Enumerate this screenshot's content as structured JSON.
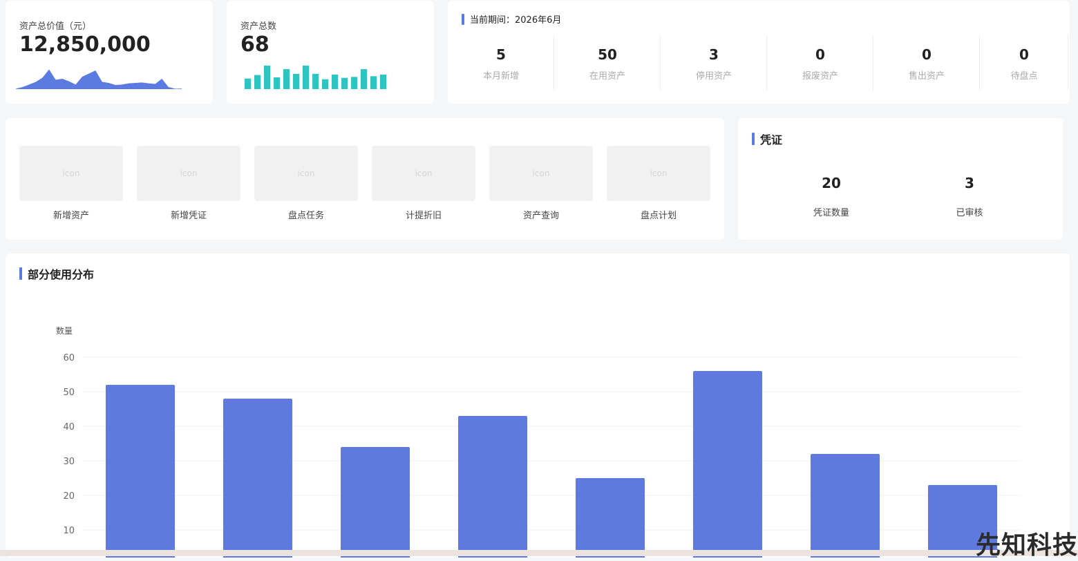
{
  "asset_value": {
    "label": "资产总价值（元）",
    "value": "12,850,000"
  },
  "asset_count": {
    "label": "资产总数",
    "value": "68",
    "bars": [
      0.45,
      0.6,
      1.0,
      0.5,
      0.85,
      0.65,
      1.0,
      0.65,
      0.42,
      0.62,
      0.48,
      0.52,
      0.85,
      0.55,
      0.62
    ],
    "bar_color": "#2ec5c0"
  },
  "area_color": "#5b7be0",
  "area_points": [
    0.02,
    0.1,
    0.22,
    0.35,
    0.55,
    0.95,
    0.45,
    0.5,
    0.38,
    0.22,
    0.6,
    0.75,
    0.9,
    0.35,
    0.3,
    0.2,
    0.22,
    0.28,
    0.3,
    0.32,
    0.28,
    0.25,
    0.5,
    0.1,
    0.02,
    0.03
  ],
  "period": {
    "title": "当前期间：2026年6月",
    "stats": [
      {
        "value": "5",
        "label": "本月新增"
      },
      {
        "value": "50",
        "label": "在用资产"
      },
      {
        "value": "3",
        "label": "停用资产"
      },
      {
        "value": "0",
        "label": "报废资产"
      },
      {
        "value": "0",
        "label": "售出资产"
      },
      {
        "value": "0",
        "label": "待盘点"
      }
    ]
  },
  "shortcuts": {
    "placeholder": "icon",
    "items": [
      {
        "label": "新增资产"
      },
      {
        "label": "新增凭证"
      },
      {
        "label": "盘点任务"
      },
      {
        "label": "计提折旧"
      },
      {
        "label": "资产查询"
      },
      {
        "label": "盘点计划"
      }
    ]
  },
  "voucher": {
    "title": "凭证",
    "stats": [
      {
        "value": "20",
        "label": "凭证数量"
      },
      {
        "value": "3",
        "label": "已审核"
      }
    ]
  },
  "usage": {
    "title": "部分使用分布"
  },
  "chart_data": {
    "type": "bar",
    "ylabel": "数量",
    "yticks": [
      10,
      20,
      30,
      40,
      50,
      60
    ],
    "ylim": [
      0,
      60
    ],
    "values": [
      52,
      48,
      34,
      43,
      25,
      56,
      32,
      23
    ],
    "color": "#5e7ade",
    "grid": true
  },
  "watermark": "先知科技"
}
